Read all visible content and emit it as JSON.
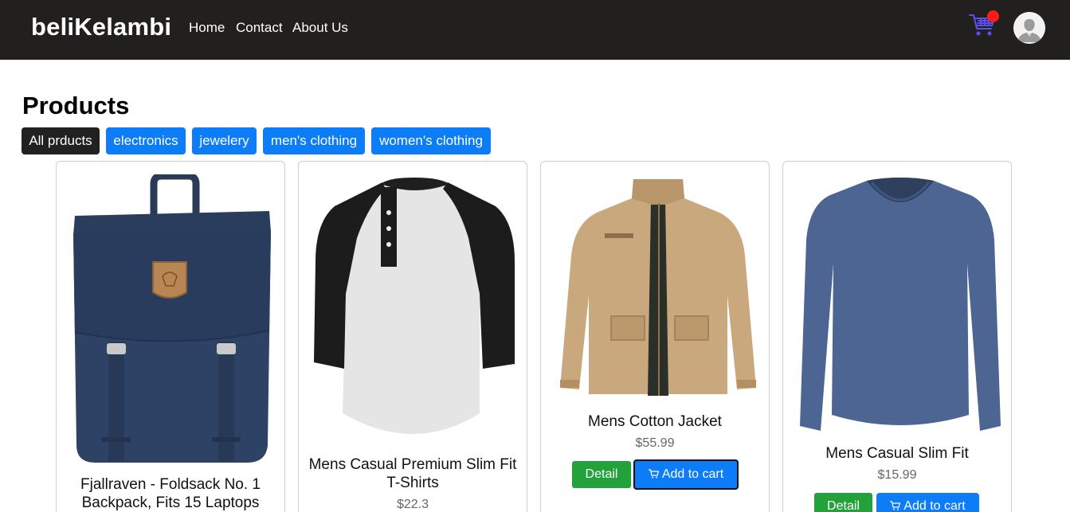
{
  "navbar": {
    "brand": "beliKelambi",
    "links": [
      "Home",
      "Contact",
      "About Us"
    ]
  },
  "page": {
    "title": "Products"
  },
  "filters": [
    {
      "label": "All prducts",
      "active": true
    },
    {
      "label": "electronics",
      "active": false
    },
    {
      "label": "jewelery",
      "active": false
    },
    {
      "label": "men's clothing",
      "active": false
    },
    {
      "label": "women's clothing",
      "active": false
    }
  ],
  "products": [
    {
      "title": "Fjallraven - Foldsack No. 1 Backpack, Fits 15 Laptops",
      "price": "",
      "image": "backpack"
    },
    {
      "title": "Mens Casual Premium Slim Fit T-Shirts",
      "price": "$22.3",
      "image": "raglan-tshirt"
    },
    {
      "title": "Mens Cotton Jacket",
      "price": "$55.99",
      "image": "cotton-jacket"
    },
    {
      "title": "Mens Casual Slim Fit",
      "price": "$15.99",
      "image": "long-sleeve-shirt"
    }
  ],
  "buttons": {
    "detail": "Detail",
    "add_to_cart": "Add to cart"
  },
  "colors": {
    "navbar": "#221f1f",
    "primary": "#0d7cf7",
    "success": "#23a13a",
    "cart_badge": "#ff1a1a"
  }
}
